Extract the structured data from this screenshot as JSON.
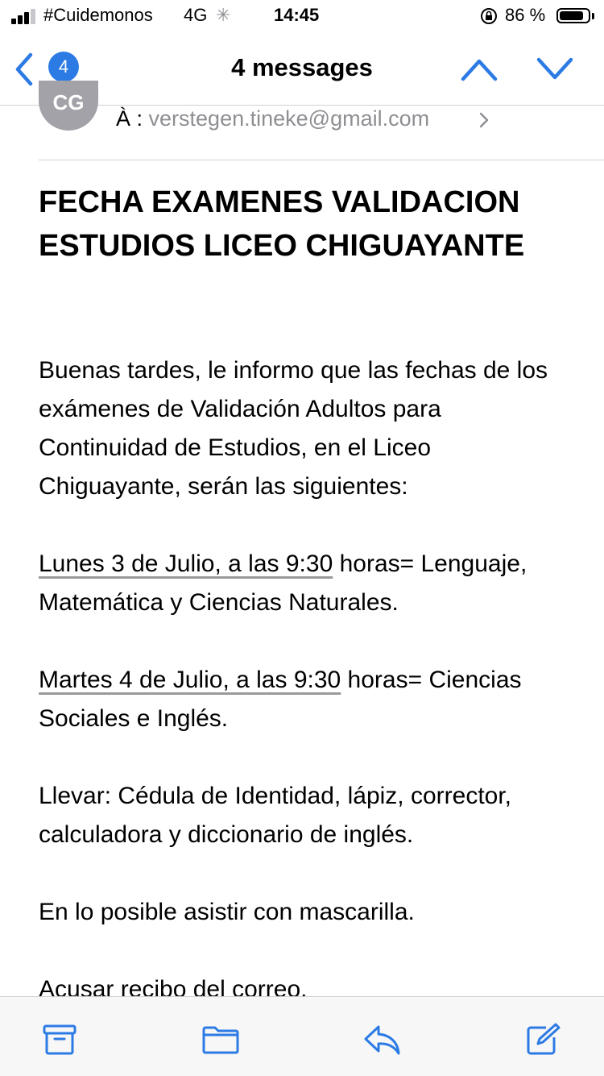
{
  "status_bar": {
    "carrier": "#Cuidemonos",
    "network": "4G",
    "time": "14:45",
    "battery_pct": "86 %",
    "battery_level": 0.86,
    "signal_bars": 3
  },
  "nav": {
    "unread_count": "4",
    "title": "4 messages"
  },
  "header": {
    "avatar_initials": "CG",
    "to_prefix": "À :",
    "to_address": "verstegen.tineke@gmail.com"
  },
  "email": {
    "subject": "FECHA EXAMENES VALIDACION ESTUDIOS LICEO CHIGUAYANTE",
    "intro": "Buenas tardes, le informo que las fechas de los exámenes de Validación Adultos para Continuidad de Estudios, en el Liceo Chiguayante, serán las siguientes:",
    "exam1_date": "Lunes 3 de Julio, a las 9:30",
    "exam1_rest": " horas= Lenguaje, Matemática y Ciencias Naturales.",
    "exam2_date": "Martes 4 de Julio, a las 9:30",
    "exam2_rest": " horas= Ciencias Sociales e Inglés.",
    "bring": "Llevar: Cédula de Identidad, lápiz, corrector, calculadora y diccionario de inglés.",
    "mask": "En lo posible asistir con mascarilla.",
    "ack": "Acusar recibo del correo."
  },
  "icons": {
    "back": "chevron-left-icon",
    "up": "chevron-up-icon",
    "down": "chevron-down-icon",
    "archive": "archive-icon",
    "folder": "folder-icon",
    "reply": "reply-icon",
    "compose": "compose-icon"
  },
  "colors": {
    "accent": "#2c7be5",
    "secondary_text": "#8e8e93"
  }
}
